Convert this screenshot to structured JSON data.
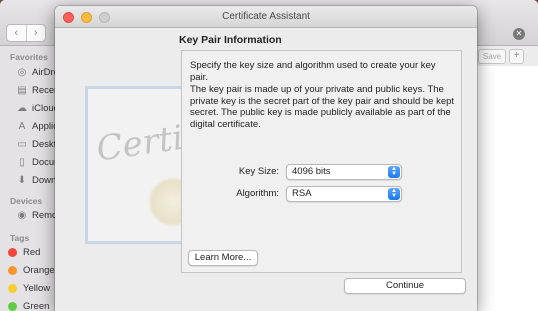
{
  "finder": {
    "search_clear": "✕",
    "save_label": "Save",
    "add_label": "+",
    "sidebar": {
      "favorites_header": "Favorites",
      "favorites": [
        {
          "label": "AirDrop",
          "icon": "airdrop-icon"
        },
        {
          "label": "Recents",
          "icon": "recents-icon"
        },
        {
          "label": "iCloud",
          "icon": "icloud-icon"
        },
        {
          "label": "Applications",
          "icon": "applications-icon"
        },
        {
          "label": "Desktop",
          "icon": "desktop-icon"
        },
        {
          "label": "Documents",
          "icon": "documents-icon"
        },
        {
          "label": "Downloads",
          "icon": "downloads-icon"
        }
      ],
      "devices_header": "Devices",
      "devices": [
        {
          "label": "Remote Disc",
          "icon": "disc-icon"
        }
      ],
      "tags_header": "Tags",
      "tags": [
        {
          "label": "Red",
          "color": "#f4463f"
        },
        {
          "label": "Orange",
          "color": "#f8952d"
        },
        {
          "label": "Yellow",
          "color": "#f8cd2f"
        },
        {
          "label": "Green",
          "color": "#5fcc46"
        }
      ]
    }
  },
  "assistant": {
    "window_title": "Certificate Assistant",
    "section_title": "Key Pair Information",
    "intro": "Specify the key size and algorithm used to create your key pair.",
    "description": "The key pair is made up of your private and public keys. The private key is the secret part of the key pair and should be kept secret. The public key is made publicly available as part of the digital certificate.",
    "key_size_label": "Key Size:",
    "key_size_value": "4096 bits",
    "algorithm_label": "Algorithm:",
    "algorithm_value": "RSA",
    "learn_more_label": "Learn More...",
    "continue_label": "Continue",
    "watermark_text": "Certificate",
    "accent_color": "#1a79f2"
  }
}
